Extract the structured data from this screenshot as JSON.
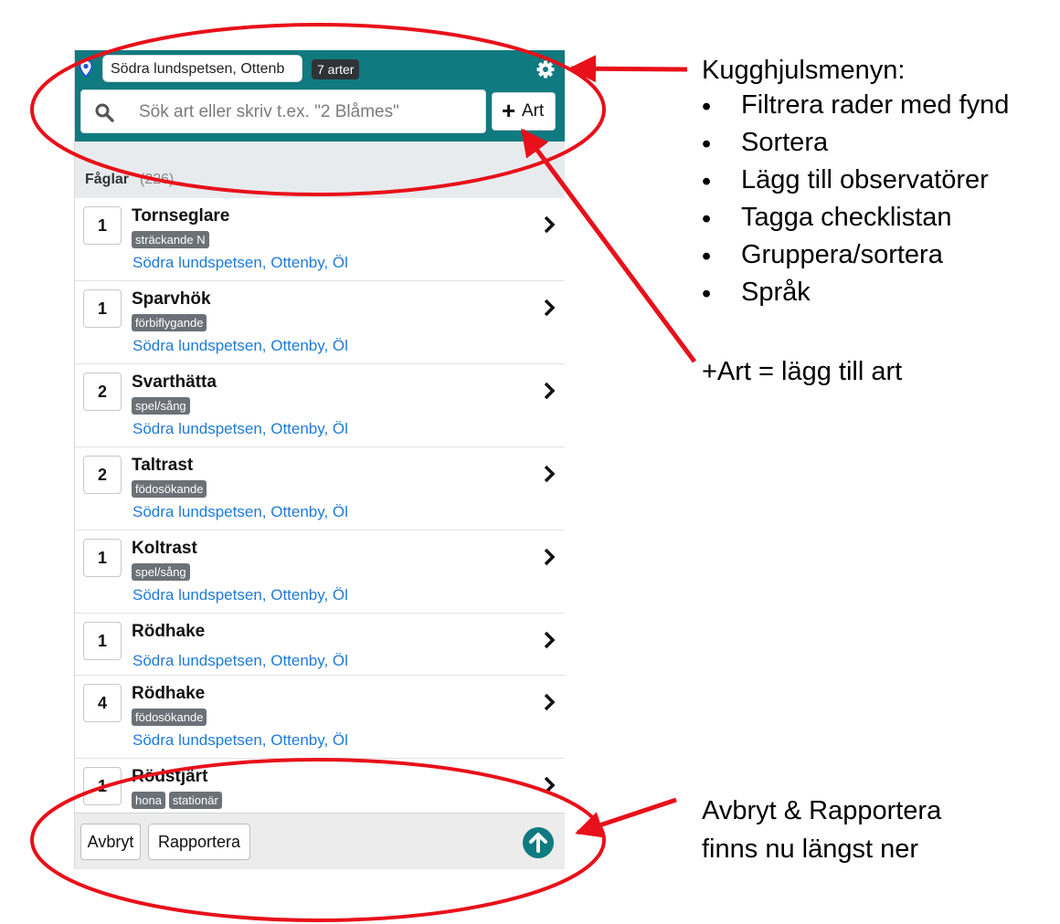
{
  "header": {
    "location_value": "Södra lundspetsen, Ottenb",
    "species_badge": "7 arter",
    "search_placeholder": "Sök art eller skriv t.ex. \"2 Blåmes\"",
    "add_button_label": "Art"
  },
  "group": {
    "name": "Fåglar",
    "count": "(226)"
  },
  "rows": [
    {
      "qty": "1",
      "species": "Tornseglare",
      "tags": [
        "sträckande N"
      ],
      "location": "Södra lundspetsen, Ottenby, Öl"
    },
    {
      "qty": "1",
      "species": "Sparvhök",
      "tags": [
        "förbiflygande"
      ],
      "location": "Södra lundspetsen, Ottenby, Öl"
    },
    {
      "qty": "2",
      "species": "Svarthätta",
      "tags": [
        "spel/sång"
      ],
      "location": "Södra lundspetsen, Ottenby, Öl"
    },
    {
      "qty": "2",
      "species": "Taltrast",
      "tags": [
        "födosökande"
      ],
      "location": "Södra lundspetsen, Ottenby, Öl"
    },
    {
      "qty": "1",
      "species": "Koltrast",
      "tags": [
        "spel/sång"
      ],
      "location": "Södra lundspetsen, Ottenby, Öl"
    },
    {
      "qty": "1",
      "species": "Rödhake",
      "tags": [],
      "location": "Södra lundspetsen, Ottenby, Öl"
    },
    {
      "qty": "4",
      "species": "Rödhake",
      "tags": [
        "födosökande"
      ],
      "location": "Södra lundspetsen, Ottenby, Öl"
    },
    {
      "qty": "1",
      "species": "Rödstjärt",
      "tags": [
        "hona",
        "stationär"
      ],
      "location": ""
    }
  ],
  "footer": {
    "cancel_label": "Avbryt",
    "report_label": "Rapportera"
  },
  "annotations": {
    "gear_title": "Kugghjulsmenyn:",
    "gear_items": [
      "Filtrera rader med fynd",
      "Sortera",
      "Lägg till observatörer",
      "Tagga checklistan",
      "Gruppera/sortera",
      "Språk"
    ],
    "bullet": "•",
    "add_note": "+Art = lägg till art",
    "bottom_note_line1": "Avbryt & Rapportera",
    "bottom_note_line2": "finns nu längst ner"
  },
  "colors": {
    "header_bg": "#0f7a7f",
    "link": "#1f7ad6",
    "tag_bg": "#6b7177",
    "annotation_red": "#e8101a"
  },
  "icons": {
    "location": "location-pin-icon",
    "settings": "gear-icon",
    "search": "search-icon",
    "add": "plus-icon",
    "row_nav": "chevron-right-icon",
    "scroll_top": "arrow-up-circle-icon"
  }
}
